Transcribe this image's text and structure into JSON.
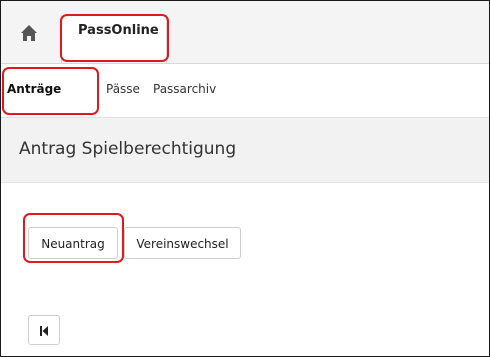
{
  "tabs": {
    "home_icon": "home-icon",
    "active_tab_label": "PassOnline"
  },
  "subnav": {
    "items": [
      {
        "label": "Anträge",
        "active": true
      },
      {
        "label": "Pässe",
        "active": false
      },
      {
        "label": "Passarchiv",
        "active": false
      }
    ]
  },
  "section": {
    "title": "Antrag Spielberechtigung"
  },
  "actions": {
    "new_application_label": "Neuantrag",
    "club_change_label": "Vereinswechsel",
    "first_page_icon": "first-page-icon"
  },
  "colors": {
    "highlight": "#e0191e",
    "tabbar_bg": "#f4f4f4",
    "header_bg": "#f2f2f2"
  }
}
